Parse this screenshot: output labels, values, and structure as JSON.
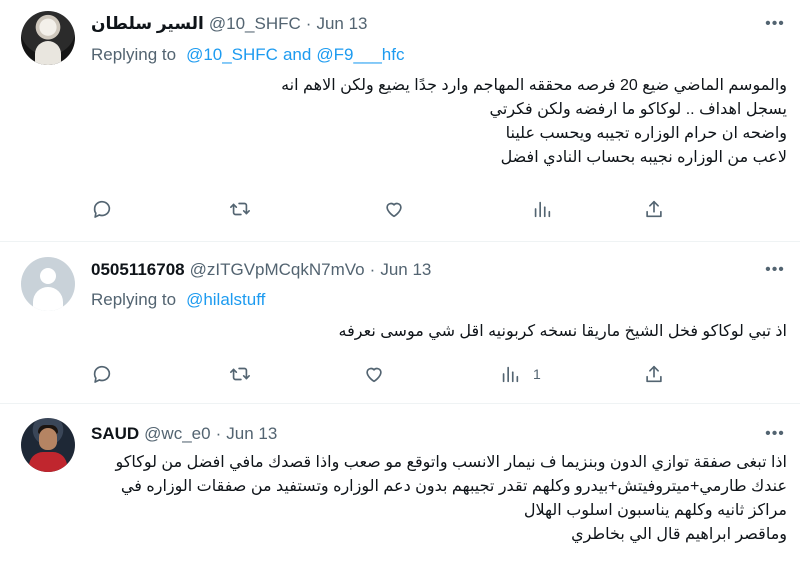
{
  "tweets": [
    {
      "name": "السير سلطان",
      "handle": "@10_SHFC",
      "date": "Jun 13",
      "reply_prefix": "Replying to",
      "reply_to_1": "@10_SHFC",
      "reply_and": "and",
      "reply_to_2": "@F9___hfc",
      "lines": [
        "والموسم الماضي ضيع 20 فرصه محققه المهاجم وارد جدًا يضيع ولكن الاهم انه",
        "يسجل اهداف .. لوكاكو ما ارفضه ولكن فكرتي",
        "واضحه ان حرام الوزاره تجيبه ويحسب علينا",
        "لاعب من الوزاره نجيبه بحساب النادي افضل"
      ],
      "views": ""
    },
    {
      "name": "0505116708",
      "handle": "@zITGVpMCqkN7mVo",
      "date": "Jun 13",
      "reply_prefix": "Replying to",
      "reply_to_1": "@hilalstuff",
      "lines": [
        "اذ تبي لوكاكو فخل الشيخ ماريقا نسخه كربونيه اقل شي موسى نعرفه"
      ],
      "views": "1"
    },
    {
      "name": "SAUD",
      "handle": "@wc_e0",
      "date": "Jun 13",
      "lines": [
        "اذا تبغى صفقة توازي الدون وبنزيما ف نيمار الانسب واتوقع مو صعب واذا قصدك مافي افضل من لوكاكو",
        "عندك طارمي+ميتروفيتش+بيدرو وكلهم تقدر تجيبهم بدون دعم الوزاره وتستفيد من صفقات الوزاره في",
        "مراكز ثانيه وكلهم يناسبون اسلوب الهلال",
        "وماقصر ابراهيم قال الي بخاطري"
      ]
    }
  ],
  "icons": {
    "more": "more-horizontal-icon",
    "reply": "reply-icon",
    "retweet": "retweet-icon",
    "like": "like-icon",
    "views": "views-icon",
    "share": "share-icon"
  },
  "colors": {
    "link": "#1d9bf0",
    "secondary_text": "#536471",
    "divider": "#eff3f4"
  }
}
